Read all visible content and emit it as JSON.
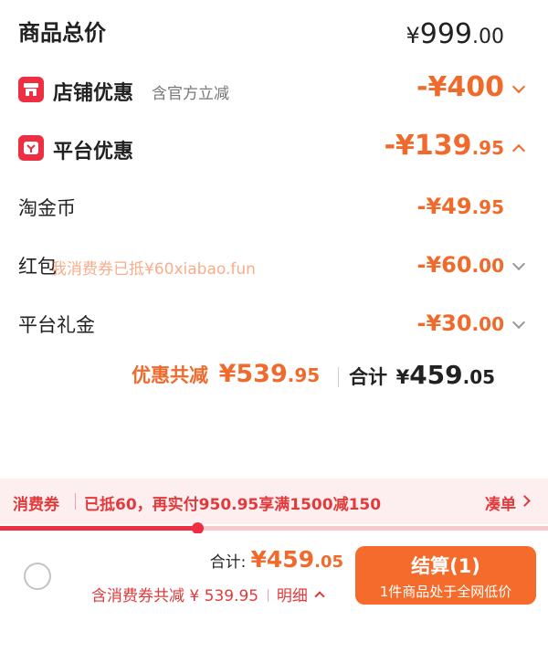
{
  "summary": {
    "total_label": "商品总价",
    "total_symbol": "¥",
    "total_int": "999",
    "total_dec": ".00"
  },
  "shop_discount": {
    "label": "店铺优惠",
    "sub": "含官方立减",
    "amount": "-¥400"
  },
  "platform_discount": {
    "label": "平台优惠",
    "amount_int": "-¥139",
    "amount_dec": ".95"
  },
  "taojinbi": {
    "label": "淘金币",
    "amount_int": "-¥49",
    "amount_dec": ".95"
  },
  "hongbao": {
    "label": "红包",
    "watermark": "我消费券已抵¥60xiabao.fun",
    "amount_int": "-¥60",
    "amount_dec": ".00"
  },
  "lijin": {
    "label": "平台礼金",
    "amount_int": "-¥30",
    "amount_dec": ".00"
  },
  "totals": {
    "discount_label": "优惠共减",
    "discount_int": "¥539",
    "discount_dec": ".95",
    "sum_label": "合计",
    "sum_symbol": "¥",
    "sum_int": "459",
    "sum_dec": ".05"
  },
  "coupon_bar": {
    "tag": "消费券",
    "text": "已抵60，再实付950.95享满1500减150",
    "action": "凑单",
    "progress": 0.36
  },
  "footer": {
    "sum_label": "合计:",
    "sum_int": "¥459",
    "sum_dec": ".05",
    "detail_text": "含消费券共减 ¥ 539.95",
    "detail_link": "明细",
    "checkout_label": "结算(1)",
    "checkout_sub": "1件商品处于全网低价"
  },
  "colors": {
    "accent_orange": "#f06a2c",
    "brand_red": "#ee2f43",
    "coupon_bg": "#fdeef0",
    "checkout_bg": "#f46b2b"
  },
  "icons": [
    "shop-icon",
    "platform-icon",
    "chevron-down-icon",
    "chevron-up-icon",
    "chevron-right-icon",
    "radio-icon"
  ]
}
